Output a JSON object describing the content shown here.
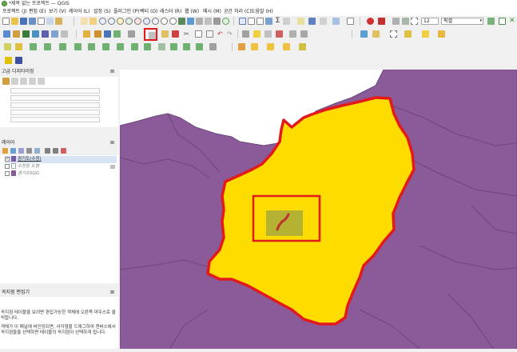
{
  "window": {
    "title": "*제목 없는 프로젝트 — QGIS"
  },
  "menu": [
    "프로젝트 (J)",
    "편집 (E)",
    "보기 (V)",
    "레이어 (L)",
    "설정 (S)",
    "플러그인 (P)",
    "벡터 (O)",
    "래스터 (R)",
    "웹 (W)",
    "메시 (M)",
    "공간 처리 (C)",
    "도움말 (H)"
  ],
  "toolbar": {
    "scale_value": "12",
    "unit_value": "픽셀"
  },
  "colors": {
    "accent_highlight": "#e31a1c",
    "feature_fill": "#ffdc00",
    "neighbor_fill": "#8a5a99",
    "selection_outline": "#e31a1c"
  },
  "panels": {
    "advanced_digitizing": {
      "title": "고급 디지타이징",
      "close": "⊠"
    },
    "layers": {
      "title": "레이어",
      "close": "⊠",
      "items": [
        {
          "name": "경기도(수정)",
          "checked": true,
          "color": "#7b5aa6"
        },
        {
          "name": "수정된 도형",
          "checked": false,
          "color": "#a0a0a0"
        },
        {
          "name": "경기도SGG",
          "checked": false,
          "color": "#8a5a99"
        }
      ]
    },
    "vertex_editor": {
      "title": "꼭지점 편집기",
      "close": "⊠",
      "text1": "꼭지점 테이블을 보려면 편집가능한 객체에 오른쪽 마우스로 클릭합니다.",
      "text2": "객체가 이 패널에 바인딩되면, 사각형을 드래그하여 캔버스에서 꼭지점들을 선택하면 테이블의 꼭지점이 선택하게 됩니다."
    }
  }
}
